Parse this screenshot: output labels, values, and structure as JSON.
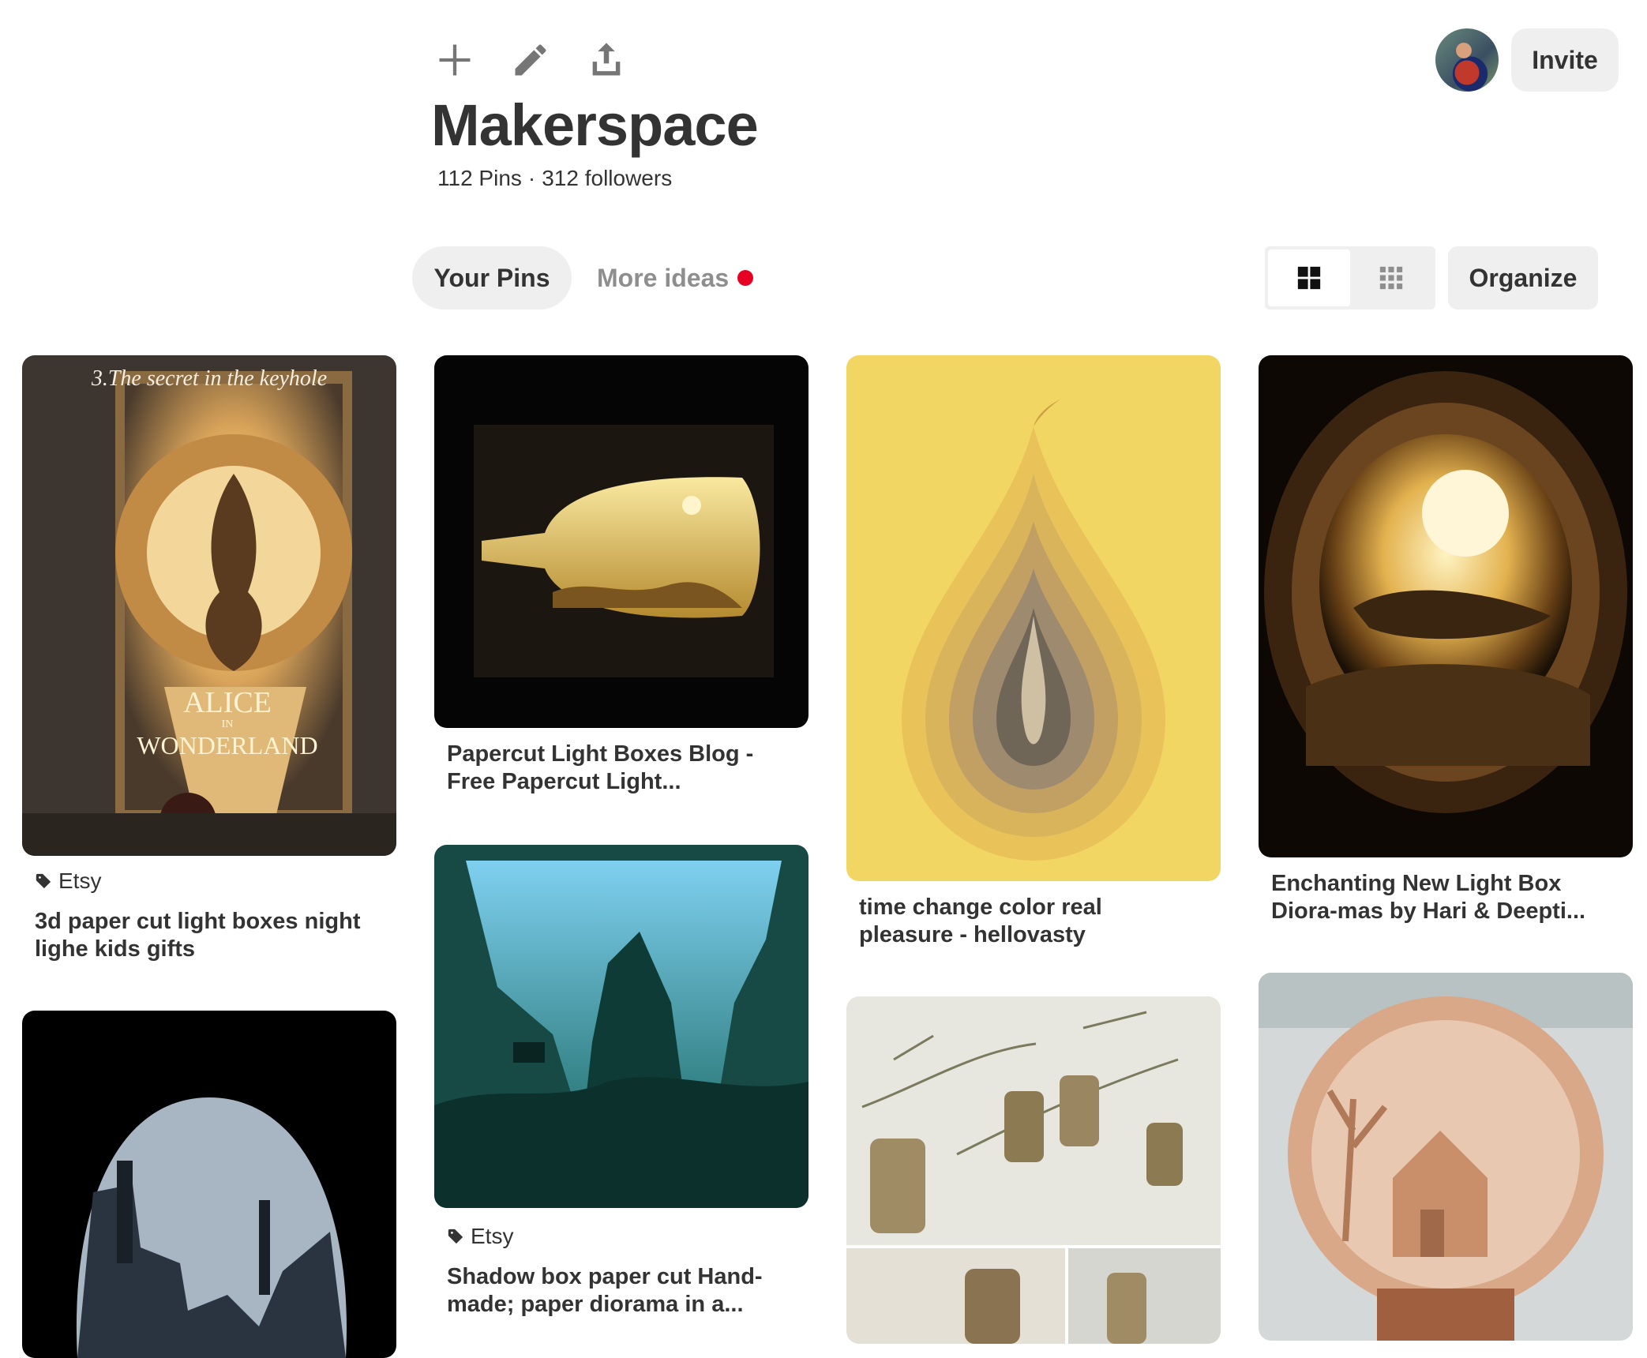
{
  "board": {
    "title": "Makerspace",
    "pins_count": "112 Pins",
    "separator": "·",
    "followers": "312 followers"
  },
  "header": {
    "add_icon": "plus-icon",
    "edit_icon": "pencil-icon",
    "share_icon": "share-upload-icon",
    "invite_label": "Invite"
  },
  "tabs": {
    "your_pins": "Your Pins",
    "more_ideas": "More ideas"
  },
  "toolbar": {
    "organize_label": "Organize",
    "view_default_icon": "grid-large-icon",
    "view_compact_icon": "grid-small-icon"
  },
  "pins": [
    {
      "source": "Etsy",
      "title": "3d paper cut light boxes night lighe kids gifts",
      "image_text": [
        "3.The secret in the keyhole",
        "ALICE",
        "IN",
        "WONDERLAND"
      ]
    },
    {
      "source": "",
      "title": "Papercut Light Boxes Blog - Free Papercut Light..."
    },
    {
      "source": "Etsy",
      "title": "Shadow box paper cut Hand-made; paper diorama in a..."
    },
    {
      "source": "",
      "title": "time change color real pleasure - hellovasty"
    },
    {
      "source": "",
      "title": "Enchanting New Light Box Diora-mas by Hari & Deepti..."
    },
    {
      "source": "",
      "title": ""
    },
    {
      "source": "",
      "title": ""
    },
    {
      "source": "",
      "title": ""
    }
  ],
  "colors": {
    "accent": "#e60023",
    "button_bg": "#efefef",
    "text": "#333333",
    "muted": "#8e8e8e"
  }
}
